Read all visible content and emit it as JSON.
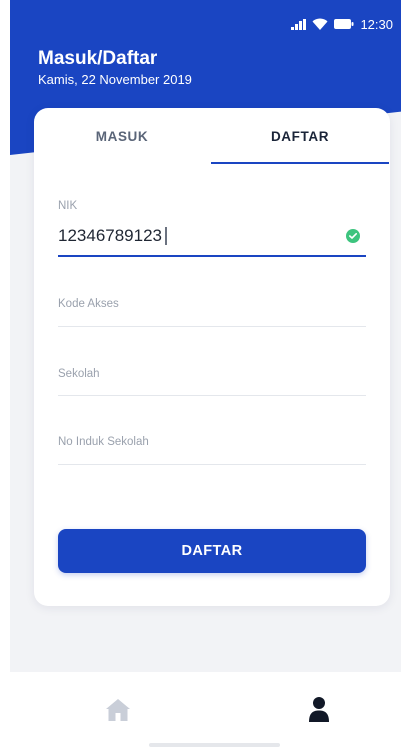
{
  "status_bar": {
    "time": "12:30"
  },
  "header": {
    "title": "Masuk/Daftar",
    "date": "Kamis, 22 November 2019"
  },
  "tabs": [
    {
      "label": "MASUK",
      "active": false
    },
    {
      "label": "DAFTAR",
      "active": true
    }
  ],
  "form": {
    "nik": {
      "label": "NIK",
      "value": "12346789123",
      "valid": true
    },
    "kode_akses": {
      "placeholder": "Kode Akses"
    },
    "sekolah": {
      "placeholder": "Sekolah"
    },
    "no_induk": {
      "placeholder": "No Induk Sekolah"
    },
    "submit_label": "DAFTAR"
  },
  "bottom_nav": [
    {
      "icon": "home-icon",
      "active": false
    },
    {
      "icon": "profile-icon",
      "active": true
    }
  ],
  "colors": {
    "primary": "#1a45c2",
    "success": "#3dc47e",
    "background": "#f2f3f6",
    "text_dark": "#1f2633",
    "text_muted": "#9aa1ad"
  }
}
